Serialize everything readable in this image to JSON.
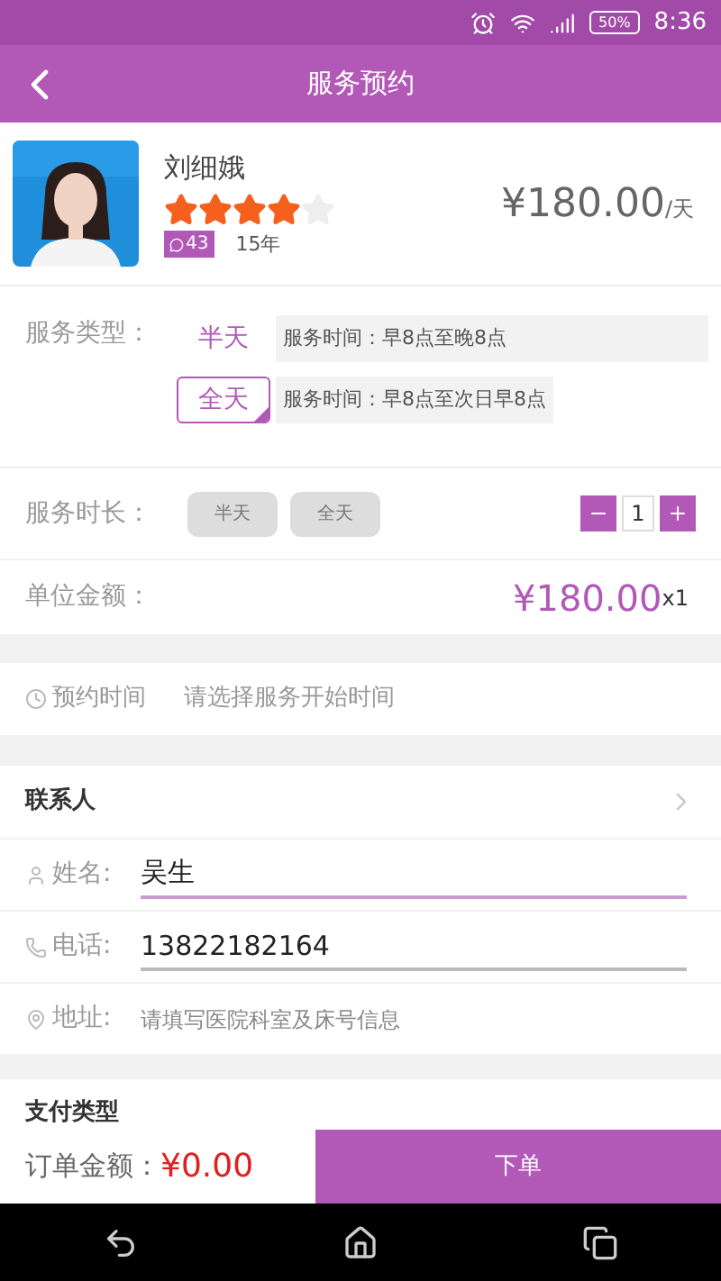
{
  "status_bar": {
    "battery": "50%",
    "time": "8:36"
  },
  "header": {
    "title": "服务预约"
  },
  "profile": {
    "name": "刘细娥",
    "stars": 4,
    "badge": "43",
    "experience": "15年",
    "price": "¥180.00",
    "unit": "/天"
  },
  "service_type": {
    "label": "服务类型：",
    "options": [
      {
        "label": "半天",
        "description": "服务时间：早8点至晚8点",
        "selected": false
      },
      {
        "label": "全天",
        "description": "服务时间：早8点至次日早8点",
        "selected": true
      }
    ]
  },
  "duration": {
    "label": "服务时长：",
    "options": [
      {
        "label": "半天",
        "disabled": true
      },
      {
        "label": "全天",
        "disabled": true
      }
    ],
    "quantity": "1"
  },
  "unit_price": {
    "label": "单位金额：",
    "amount": "¥180.00",
    "multiplier": "x1"
  },
  "appointment": {
    "label": "预约时间",
    "placeholder": "请选择服务开始时间"
  },
  "contact": {
    "title": "联系人",
    "fields": [
      {
        "kind": "name",
        "label": "姓名:",
        "value": "吴生",
        "focused": true
      },
      {
        "kind": "phone",
        "label": "电话:",
        "value": "13822182164",
        "focused": false
      },
      {
        "kind": "address",
        "label": "地址:",
        "placeholder": "请填写医院科室及床号信息"
      }
    ]
  },
  "payment": {
    "title": "支付类型"
  },
  "footer": {
    "label": "订单金额：",
    "amount": "¥0.00",
    "button": "下单"
  }
}
